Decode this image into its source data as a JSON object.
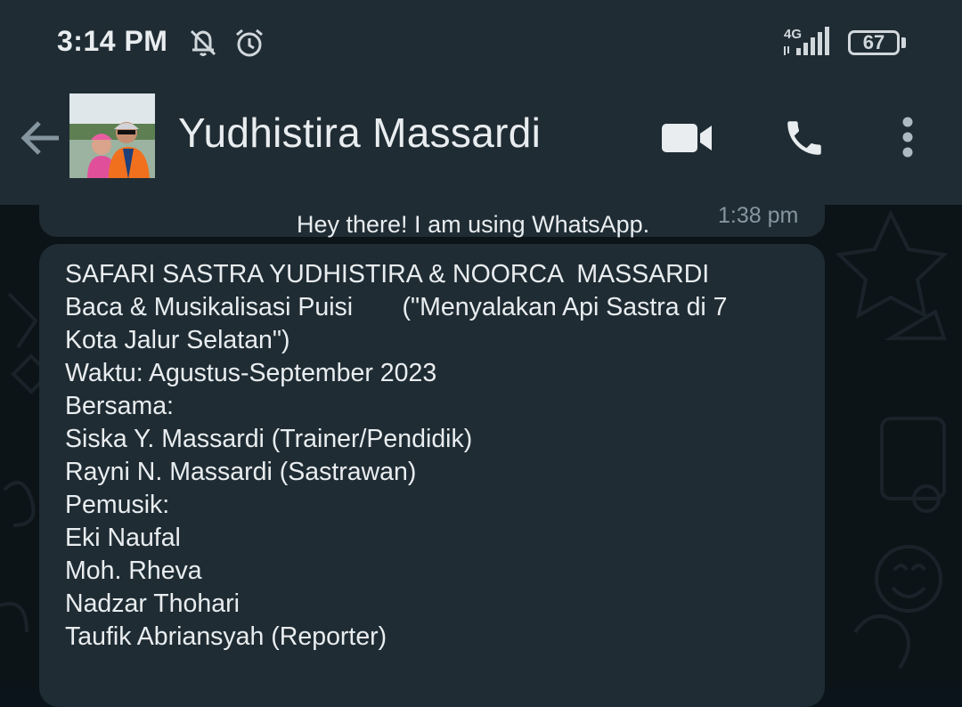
{
  "status_bar": {
    "time": "3:14 PM",
    "network": "4G",
    "battery": "67",
    "icons": [
      "notifications-off-icon",
      "alarm-icon",
      "network-4g-icon",
      "signal-icon",
      "battery-icon"
    ]
  },
  "header": {
    "contact_name": "Yudhistira Massardi",
    "icons": [
      "back-arrow-icon",
      "avatar",
      "video-call-icon",
      "voice-call-icon",
      "more-options-icon"
    ]
  },
  "previous_message": {
    "text": "Hey there! I am using WhatsApp.",
    "time": "1:38 pm"
  },
  "message": {
    "lines": [
      "SAFARI SASTRA YUDHISTIRA & NOORCA  MASSARDI",
      "Baca & Musikalisasi Puisi       (\"Menyalakan Api Sastra di 7",
      "Kota Jalur Selatan\")",
      "Waktu: Agustus-September 2023",
      "Bersama:",
      "Siska Y. Massardi (Trainer/Pendidik)",
      "Rayni N. Massardi (Sastrawan)",
      "Pemusik:",
      "Eki Naufal",
      "Moh. Rheva",
      "Nadzar Thohari",
      "Taufik Abriansyah (Reporter)"
    ]
  },
  "colors": {
    "bar": "#1f2c34",
    "bubble": "#1f2c34",
    "background": "#0b141a",
    "text": "#e9edef",
    "muted": "#8696a0"
  }
}
